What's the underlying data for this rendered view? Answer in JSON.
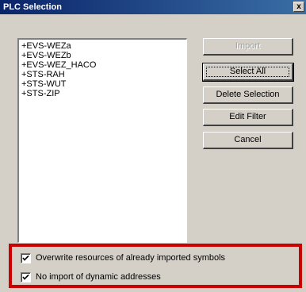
{
  "window": {
    "title": "PLC Selection",
    "close_glyph": "x"
  },
  "plc_list": {
    "items": [
      "+EVS-WEZa",
      "+EVS-WEZb",
      "+EVS-WEZ_HACO",
      "+STS-RAH",
      "+STS-WUT",
      "+STS-ZIP"
    ]
  },
  "buttons": {
    "import": "Import",
    "select_all": "Select All",
    "delete_selection": "Delete Selection",
    "edit_filter": "Edit Filter",
    "cancel": "Cancel"
  },
  "options": {
    "overwrite_resources": {
      "label": "Overwrite resources of already imported symbols",
      "checked": true
    },
    "no_dynamic_import": {
      "label": "No import of dynamic addresses",
      "checked": true
    }
  },
  "colors": {
    "dialog_bg": "#d4d0c8",
    "title_bar": "#0a246a",
    "highlight_border": "#cc0000"
  }
}
